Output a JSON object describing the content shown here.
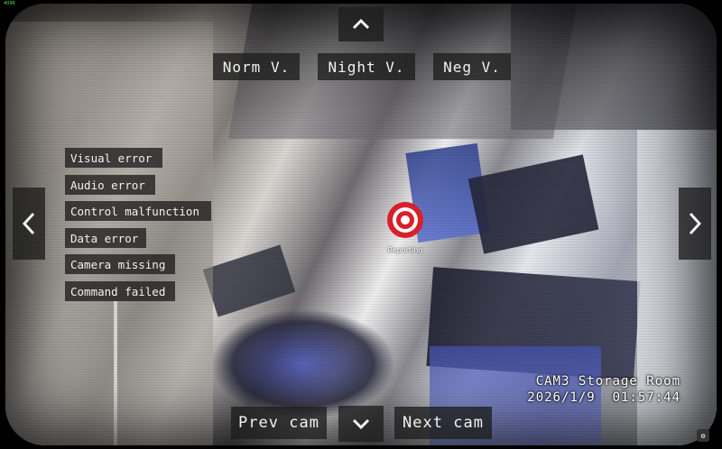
{
  "corner_label": "4096",
  "modes": {
    "normal": "Norm V.",
    "night": "Night V.",
    "negative": "Neg V."
  },
  "errors": [
    "Visual error",
    "Audio error",
    "Control malfunction",
    "Data error",
    "Camera missing",
    "Command failed"
  ],
  "navigation": {
    "up_icon": "chevron-up-icon",
    "down_icon": "chevron-down-icon",
    "left_icon": "chevron-left-icon",
    "right_icon": "chevron-right-icon",
    "prev_cam": "Prev cam",
    "next_cam": "Next cam"
  },
  "target": {
    "label": "Reporting",
    "color": "#d8202a"
  },
  "camera": {
    "name": "CAM3 Storage Room",
    "date": "2026/1/9",
    "time": "01:57:44"
  }
}
